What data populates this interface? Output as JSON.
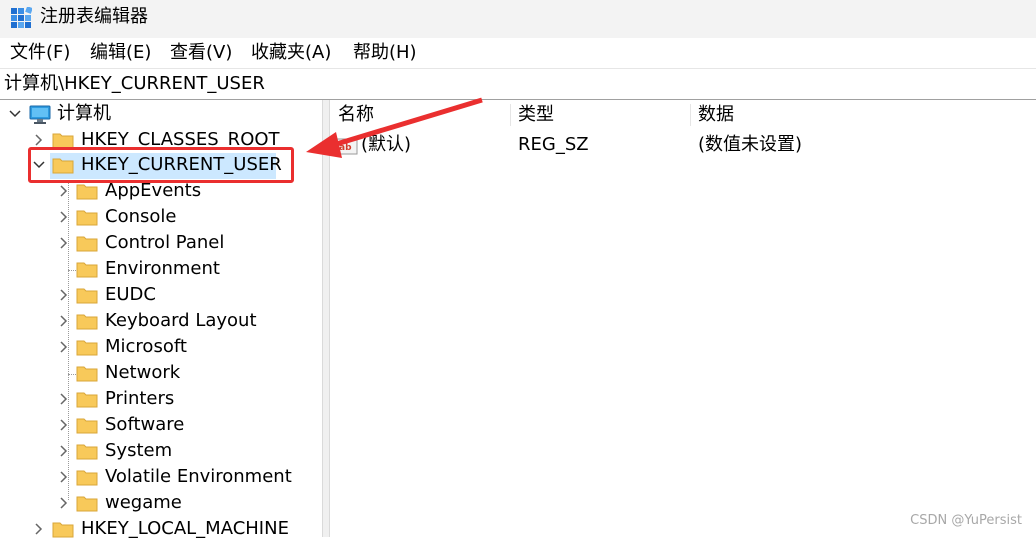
{
  "window": {
    "title": "注册表编辑器"
  },
  "menu": [
    "文件(F)",
    "编辑(E)",
    "查看(V)",
    "收藏夹(A)",
    "帮助(H)"
  ],
  "address": "计算机\\HKEY_CURRENT_USER",
  "tree": {
    "root": "计算机",
    "hives": {
      "classes_root": "HKEY_CLASSES_ROOT",
      "current_user": "HKEY_CURRENT_USER",
      "local_machine": "HKEY_LOCAL_MACHINE"
    },
    "children": [
      "AppEvents",
      "Console",
      "Control Panel",
      "Environment",
      "EUDC",
      "Keyboard Layout",
      "Microsoft",
      "Network",
      "Printers",
      "Software",
      "System",
      "Volatile Environment",
      "wegame"
    ]
  },
  "list": {
    "columns": [
      "名称",
      "类型",
      "数据"
    ],
    "rows": [
      {
        "name": "(默认)",
        "type": "REG_SZ",
        "data": "(数值未设置)"
      }
    ]
  },
  "watermark": "CSDN @YuPersist",
  "colors": {
    "selection": "#cce8ff",
    "annotation": "#ea2f2f",
    "folder": "#f8c95a"
  }
}
